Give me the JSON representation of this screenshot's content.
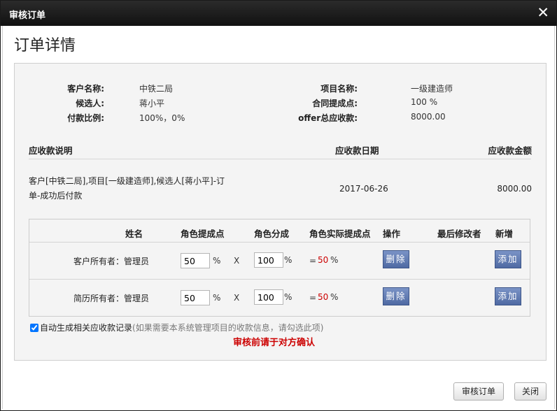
{
  "window": {
    "title": "审核订单",
    "close_glyph": "✕"
  },
  "page_title": "订单详情",
  "info": {
    "customer_label": "客户名称:",
    "customer_value": "中铁二局",
    "candidate_label": "候选人:",
    "candidate_value": "蒋小平",
    "payment_ratio_label": "付款比例:",
    "payment_ratio_value": "100%，0%",
    "project_label": "项目名称:",
    "project_value": "一级建造师",
    "contract_point_label": "合同提成点:",
    "contract_point_value": "100 %",
    "offer_total_label": "offer总应收款:",
    "offer_total_value": "8000.00"
  },
  "receivable": {
    "headers": {
      "desc": "应收款说明",
      "date": "应收款日期",
      "amount": "应收款金额"
    },
    "desc_line1": "客户[中铁二局],项目[一级建造师],候选人[蒋小平]-订",
    "desc_line2": "单-成功后付款",
    "date": "2017-06-26",
    "amount": "8000.00"
  },
  "roles": {
    "headers": {
      "name": "姓名",
      "commission_point": "角色提成点",
      "share": "角色分成",
      "actual_point": "角色实际提成点",
      "action": "操作",
      "last_modifier": "最后修改者",
      "add": "新增"
    },
    "rows": [
      {
        "label": "客户所有者：管理员",
        "commission_point": "50",
        "share": "100",
        "actual_point": "50",
        "percent": "%",
        "times": "X",
        "equals": "=",
        "delete_label": "删除",
        "add_label": "添加"
      },
      {
        "label": "简历所有者：管理员",
        "commission_point": "50",
        "share": "100",
        "actual_point": "50",
        "percent": "%",
        "times": "X",
        "equals": "=",
        "delete_label": "删除",
        "add_label": "添加"
      }
    ]
  },
  "auto_generate": {
    "checked": true,
    "label": "自动生成相关应收款记录",
    "hint": "(如果需要本系统管理项目的收款信息，请勾选此项)"
  },
  "warning": "审核前请于对方确认",
  "footer": {
    "approve_label": "审核订单",
    "close_label": "关闭"
  },
  "colors": {
    "accent_blue": "#5a74ad",
    "warning_red": "#cc0000",
    "titlebar": "#1a1a1a"
  }
}
